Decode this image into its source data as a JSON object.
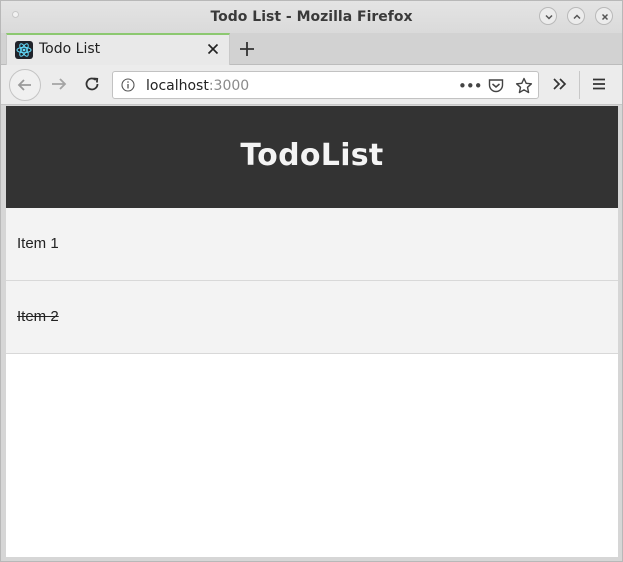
{
  "window": {
    "title": "Todo List - Mozilla Firefox"
  },
  "tab": {
    "label": "Todo List",
    "favicon": "react-logo-icon"
  },
  "navbar": {
    "url_host": "localhost",
    "url_port": ":3000",
    "more_label": "•••"
  },
  "app": {
    "title": "TodoList",
    "header_color": "#333333",
    "items": [
      {
        "label": "Item 1",
        "completed": false
      },
      {
        "label": "Item 2",
        "completed": true
      }
    ]
  }
}
